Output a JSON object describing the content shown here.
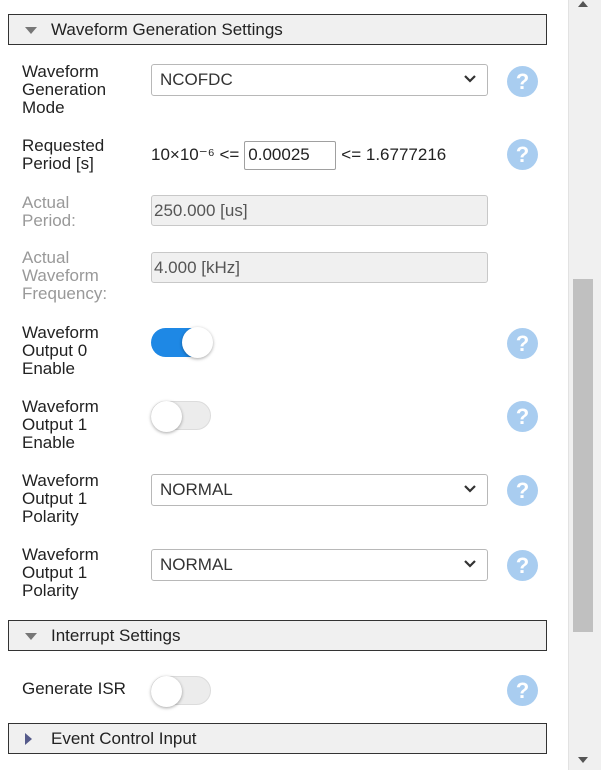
{
  "sections": {
    "waveform": "Waveform Generation Settings",
    "interrupt": "Interrupt Settings",
    "event": "Event Control Input"
  },
  "fields": {
    "mode": {
      "label_lines": [
        "Waveform",
        "Generation",
        "Mode"
      ],
      "value": "NCOFDC"
    },
    "requested_period": {
      "label_lines": [
        "Requested",
        "Period [s]"
      ],
      "min_text": "10×10⁻⁶ <=",
      "value": "0.00025",
      "max_text": "<= 1.6777216"
    },
    "actual_period": {
      "label_lines": [
        "Actual",
        "Period:"
      ],
      "value": "250.000 [us]"
    },
    "actual_frequency": {
      "label_lines": [
        "Actual",
        "Waveform",
        "Frequency:"
      ],
      "value": "4.000 [kHz]"
    },
    "output0_enable": {
      "label_lines": [
        "Waveform",
        "Output 0",
        "Enable"
      ],
      "state": true
    },
    "output1_enable": {
      "label_lines": [
        "Waveform",
        "Output 1",
        "Enable"
      ],
      "state": false
    },
    "output1_polarity_a": {
      "label_lines": [
        "Waveform",
        "Output 1",
        "Polarity"
      ],
      "value": "NORMAL"
    },
    "output1_polarity_b": {
      "label_lines": [
        "Waveform",
        "Output 1",
        "Polarity"
      ],
      "value": "NORMAL"
    },
    "generate_isr": {
      "label": "Generate ISR",
      "state": false
    }
  },
  "help_glyph": "?",
  "icons": {
    "help": "help-icon",
    "dropdown": "chevron-down-icon",
    "expanded": "triangle-down-icon",
    "collapsed": "triangle-right-icon"
  },
  "colors": {
    "toggle_on": "#1e88e5",
    "help_bg": "#a9cdf0",
    "header_bg": "#f0f0f0"
  }
}
